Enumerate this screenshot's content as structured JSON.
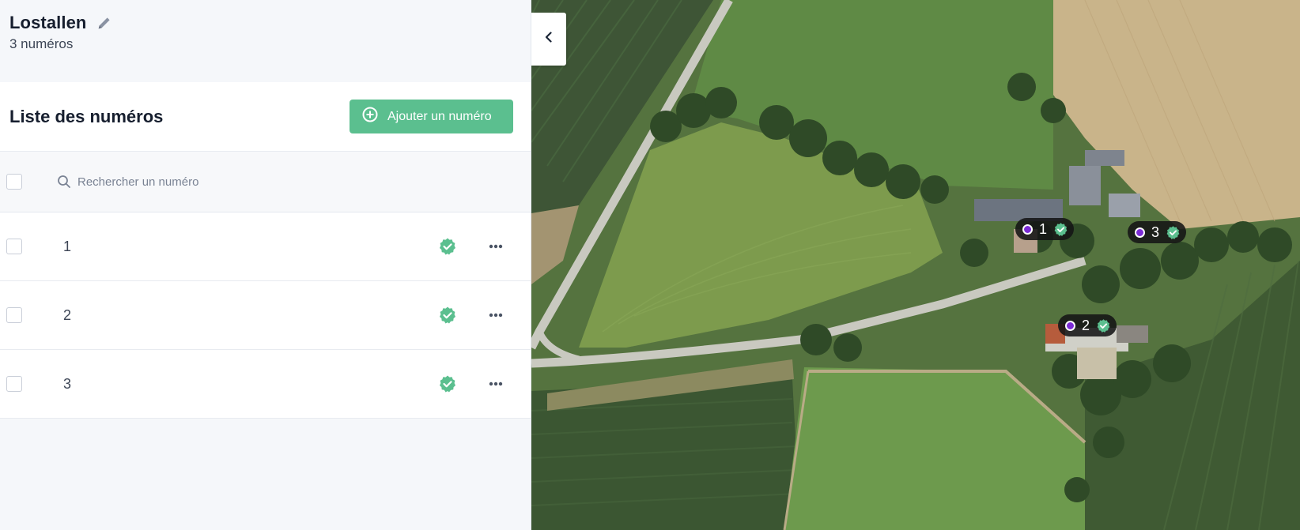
{
  "voie": {
    "name": "Lostallen",
    "count_text": "3 numéros"
  },
  "list": {
    "title": "Liste des numéros",
    "add_button_label": "Ajouter un numéro",
    "search_placeholder": "Rechercher un numéro"
  },
  "rows": [
    {
      "number": "1",
      "status": "certified"
    },
    {
      "number": "2",
      "status": "certified"
    },
    {
      "number": "3",
      "status": "certified"
    }
  ],
  "map": {
    "markers": [
      {
        "label": "1"
      },
      {
        "label": "2"
      },
      {
        "label": "3"
      }
    ]
  },
  "colors": {
    "accent_green": "#5bbf8f",
    "check_green": "#5bbf8f",
    "marker_dot": "#7b2bd6"
  },
  "icons": {
    "edit": "pencil-icon",
    "add": "plus-circle-icon",
    "search": "search-icon",
    "status": "check-badge-icon",
    "more": "more-horizontal-icon",
    "collapse": "chevron-left-icon"
  }
}
